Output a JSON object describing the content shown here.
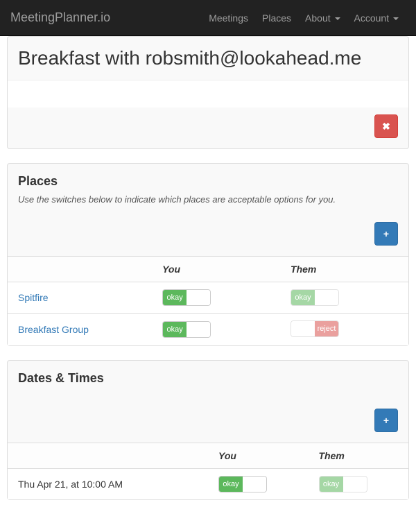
{
  "navbar": {
    "brand": "MeetingPlanner.io",
    "items": [
      "Meetings",
      "Places",
      "About",
      "Account"
    ],
    "dropdown_flags": [
      false,
      false,
      true,
      true
    ]
  },
  "meeting": {
    "title": "Breakfast with robsmith@lookahead.me"
  },
  "places": {
    "heading": "Places",
    "hint": "Use the switches below to indicate which places are acceptable options for you.",
    "col_you": "You",
    "col_them": "Them",
    "rows": [
      {
        "name": "Spitfire",
        "you": "okay",
        "them": "okay",
        "them_faded": true
      },
      {
        "name": "Breakfast Group",
        "you": "okay",
        "them": "reject",
        "them_faded": true
      }
    ]
  },
  "times": {
    "heading": "Dates & Times",
    "col_you": "You",
    "col_them": "Them",
    "rows": [
      {
        "label": "Thu Apr 21, at 10:00 AM",
        "you": "okay",
        "them": "okay",
        "them_faded": true
      }
    ]
  },
  "labels": {
    "okay": "okay",
    "reject": "reject"
  },
  "icons": {
    "close": "✖",
    "plus": "+"
  }
}
